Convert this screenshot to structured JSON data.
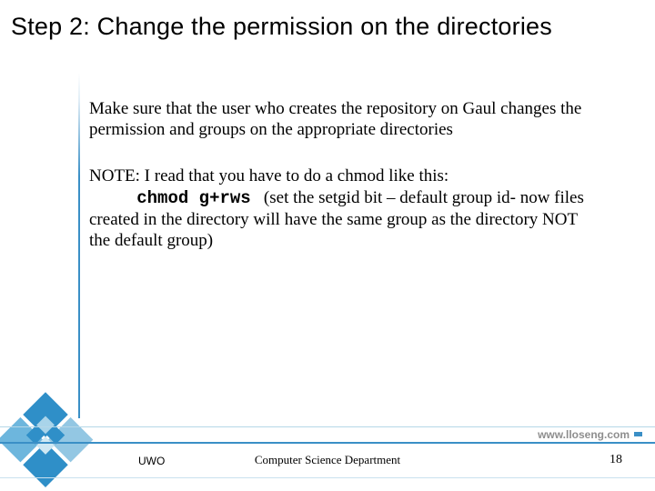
{
  "title": "Step 2: Change the permission on the directories",
  "para1": "Make sure that the user who creates the repository on Gaul changes the permission and groups on the appropriate directories",
  "note_prefix": "NOTE: I read that you have to do a chmod like this:",
  "code_indent": "           ",
  "code": "chmod g+rws",
  "after_code": "   (set the setgid bit – default group id- now files created in the directory will have the same group as the directory NOT the default group)",
  "url": "www.lloseng.com",
  "footer_left": "UWO",
  "footer_center": "Computer Science Department",
  "page_number": "18"
}
